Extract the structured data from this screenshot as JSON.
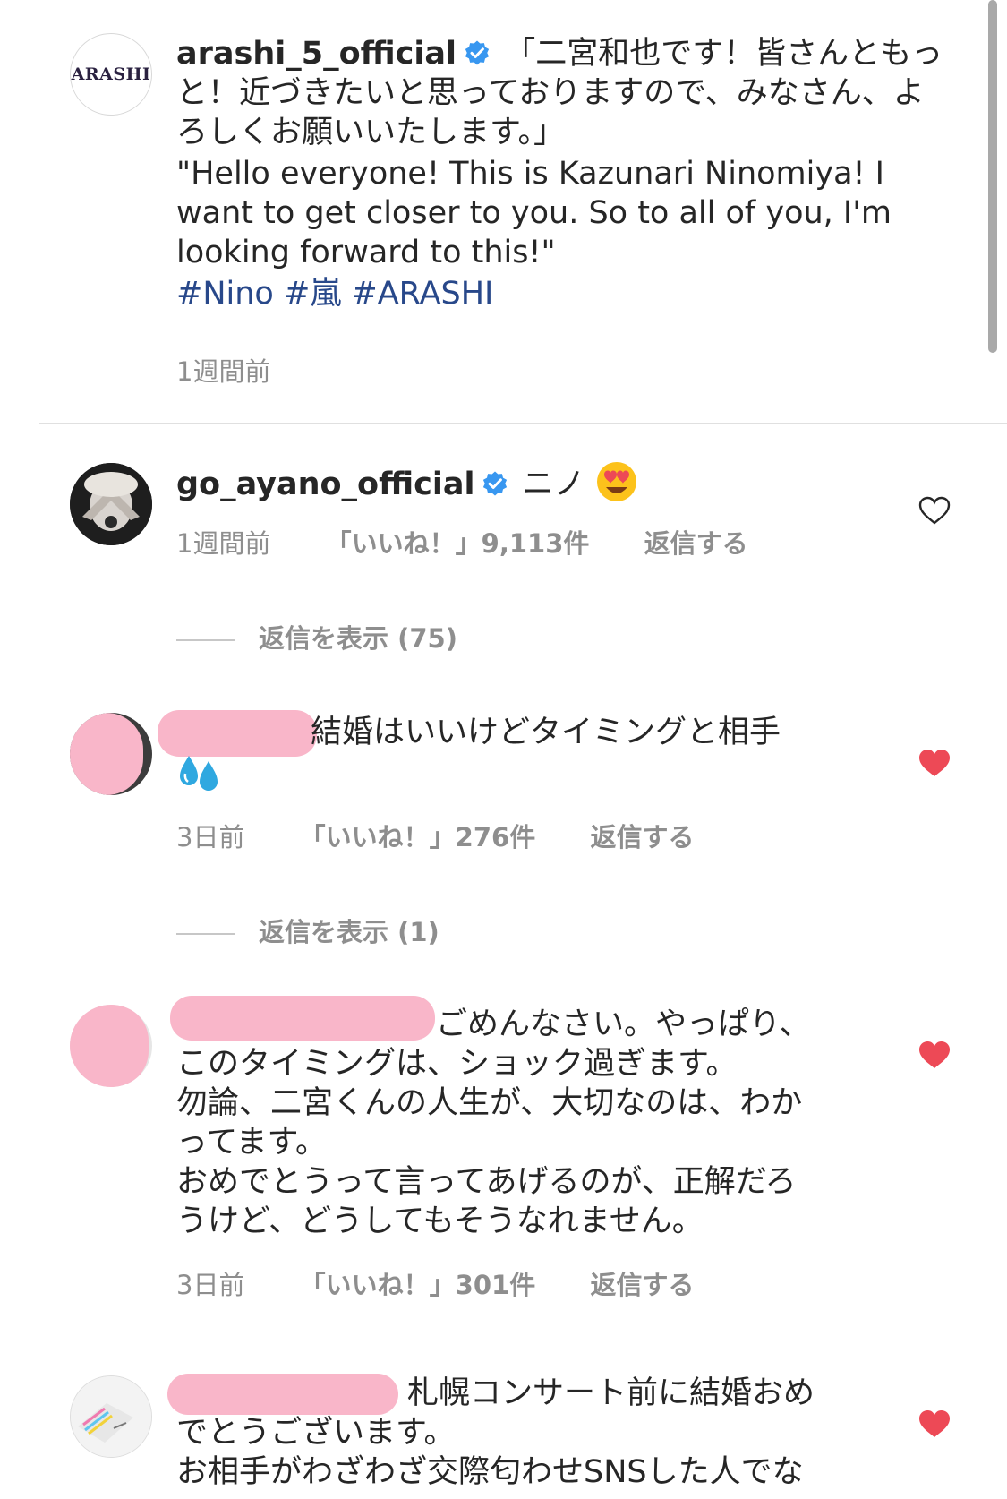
{
  "post": {
    "username": "arashi_5_official",
    "avatar_text": "ARASHI",
    "caption_jp": "「二宮和也です！皆さんともっと！近づきたいと思っておりますので、みなさん、よろしくお願いいたします。」",
    "caption_en": "\"Hello everyone!  This is Kazunari Ninomiya!  I want to get closer to you.  So to all of you, I'm looking forward to this!\"",
    "hashtags": "#Nino #嵐 #ARASHI",
    "time": "1週間前"
  },
  "comments": [
    {
      "username": "go_ayano_official",
      "text": "ニノ",
      "emoji": "smiling-face-heart-eyes",
      "time": "1週間前",
      "likes": "「いいね！」9,113件",
      "reply": "返信する",
      "view_replies": "返信を表示 (75)",
      "liked": false
    },
    {
      "username": "",
      "text": "結婚はいいけどタイミングと相手",
      "emoji": "sweat-droplets",
      "time": "3日前",
      "likes": "「いいね！」276件",
      "reply": "返信する",
      "view_replies": "返信を表示 (1)",
      "liked": true
    },
    {
      "username": "",
      "text_lines": [
        "ごめんなさい。やっぱり、",
        "このタイミングは、ショック過ぎます。",
        "勿論、二宮くんの人生が、大切なのは、わか",
        "ってます。",
        "おめでとうって言ってあげるのが、正解だろ",
        "うけど、どうしてもそうなれません。"
      ],
      "time": "3日前",
      "likes": "「いいね！」301件",
      "reply": "返信する",
      "liked": true
    },
    {
      "username": "",
      "text_lines": [
        "札幌コンサート前に結婚おめ",
        "でとうございます。",
        "お相手がわざわざ交際匂わせSNSした人でな"
      ],
      "liked": true
    }
  ],
  "colors": {
    "heart_liked": "#ed4956",
    "verified": "#3897f0",
    "hashtag": "#28488a",
    "meta_gray": "#8e8e8e",
    "redaction": "#f9b6c9"
  }
}
